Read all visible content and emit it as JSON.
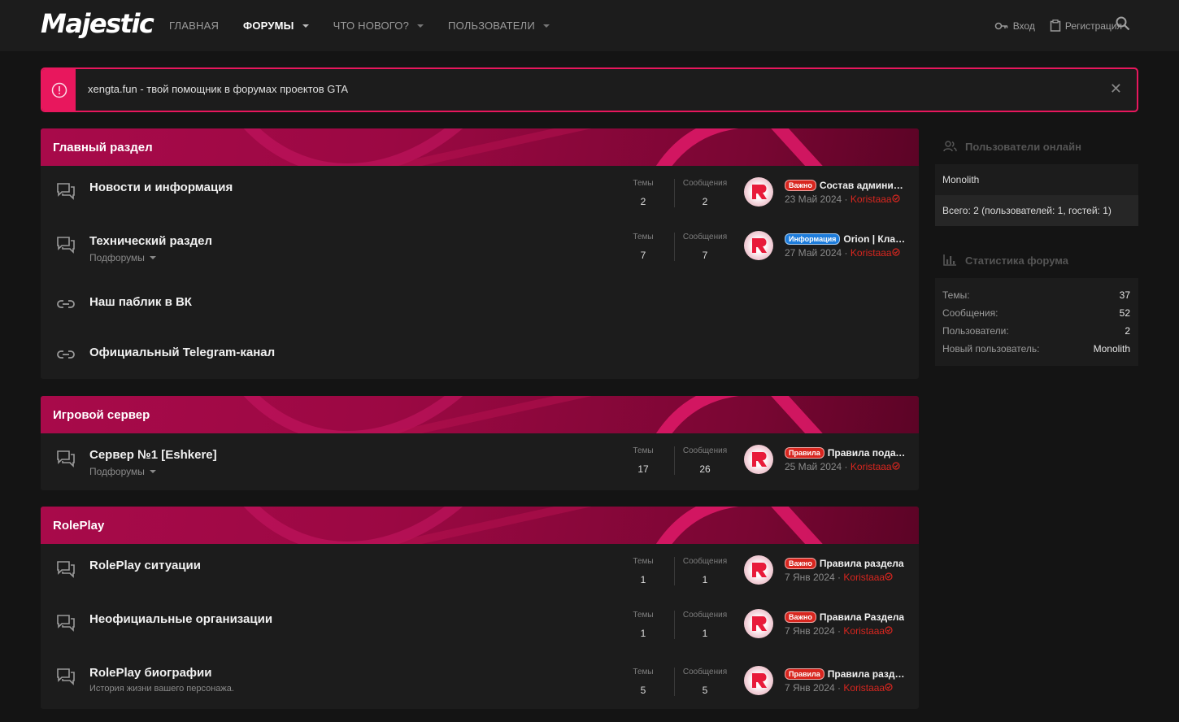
{
  "header": {
    "logo": "Majestic",
    "nav": [
      {
        "label": "ГЛАВНАЯ",
        "active": false,
        "dropdown": false
      },
      {
        "label": "ФОРУМЫ",
        "active": true,
        "dropdown": true
      },
      {
        "label": "ЧТО НОВОГО?",
        "active": false,
        "dropdown": true
      },
      {
        "label": "ПОЛЬЗОВАТЕЛИ",
        "active": false,
        "dropdown": true
      }
    ],
    "login_label": "Вход",
    "register_label": "Регистрация"
  },
  "notice": {
    "text": "xengta.fun - твой помощник в форумах проектов GTA",
    "close_glyph": "✕"
  },
  "categories": [
    {
      "title": "Главный раздел",
      "nodes": [
        {
          "title": "Новости и информация",
          "type": "forum",
          "themes_label": "Темы",
          "themes": "2",
          "msgs_label": "Сообщения",
          "msgs": "2",
          "last": {
            "badge": "Важно",
            "badge_color": "red",
            "title": "Состав администрации",
            "date": "23 Май 2024",
            "user": "Koristaaa"
          }
        },
        {
          "title": "Технический раздел",
          "sub": "Подфорумы",
          "type": "forum",
          "themes_label": "Темы",
          "themes": "7",
          "msgs_label": "Сообщения",
          "msgs": "7",
          "last": {
            "badge": "Информация",
            "badge_color": "blue",
            "title": "Orion | Клавиатура",
            "date": "27 Май 2024",
            "user": "Koristaaa"
          }
        },
        {
          "title": "Наш паблик в ВК",
          "type": "link"
        },
        {
          "title": "Официальный Telegram-канал",
          "type": "link"
        }
      ]
    },
    {
      "title": "Игровой сервер",
      "nodes": [
        {
          "title": "Сервер №1 [Eshkere]",
          "sub": "Подфорумы",
          "type": "forum",
          "themes_label": "Темы",
          "themes": "17",
          "msgs_label": "Сообщения",
          "msgs": "26",
          "last": {
            "badge": "Правила",
            "badge_color": "red",
            "title": "Правила подачи жалоб",
            "date": "25 Май 2024",
            "user": "Koristaaa"
          }
        }
      ]
    },
    {
      "title": "RolePlay",
      "nodes": [
        {
          "title": "RolePlay ситуации",
          "type": "forum",
          "themes_label": "Темы",
          "themes": "1",
          "msgs_label": "Сообщения",
          "msgs": "1",
          "last": {
            "badge": "Важно",
            "badge_color": "red",
            "title": "Правила раздела",
            "date": "7 Янв 2024",
            "user": "Koristaaa"
          }
        },
        {
          "title": "Неофициальные организации",
          "type": "forum",
          "themes_label": "Темы",
          "themes": "1",
          "msgs_label": "Сообщения",
          "msgs": "1",
          "last": {
            "badge": "Важно",
            "badge_color": "red",
            "title": "Правила Раздела",
            "date": "7 Янв 2024",
            "user": "Koristaaa"
          }
        },
        {
          "title": "RolePlay биографии",
          "desc": "История жизни вашего персонажа.",
          "type": "forum",
          "themes_label": "Темы",
          "themes": "5",
          "msgs_label": "Сообщения",
          "msgs": "5",
          "last": {
            "badge": "Правила",
            "badge_color": "red",
            "title": "Правила раздела",
            "date": "7 Янв 2024",
            "user": "Koristaaa"
          }
        }
      ]
    }
  ],
  "sidebar": {
    "online": {
      "title": "Пользователи онлайн",
      "users": "Monolith",
      "total": "Всего: 2 (пользователей: 1, гостей: 1)"
    },
    "stats": {
      "title": "Статистика форума",
      "rows": [
        {
          "k": "Темы:",
          "v": "37"
        },
        {
          "k": "Сообщения:",
          "v": "52"
        },
        {
          "k": "Пользователи:",
          "v": "2"
        },
        {
          "k": "Новый пользователь:",
          "v": "Monolith"
        }
      ]
    }
  },
  "colors": {
    "accent": "#e8175d",
    "badge_red": "#d8261f",
    "badge_blue": "#1e7ddc"
  }
}
